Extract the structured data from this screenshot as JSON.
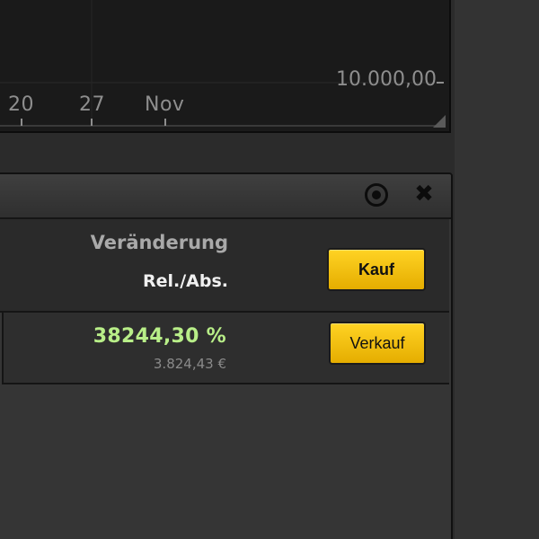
{
  "chart": {
    "x_ticks": [
      "20",
      "27",
      "Nov"
    ],
    "y_tick": "10.000,00"
  },
  "window": {
    "target_icon": "target-icon",
    "close_icon": "close-icon",
    "close_glyph": "✖"
  },
  "table": {
    "column_header": "Veränderung",
    "column_subheader": "Rel./Abs.",
    "rows": [
      {
        "rel_change": "38244,30 %",
        "abs_change": "3.824,43 €"
      }
    ]
  },
  "buttons": {
    "buy_label": "Kauf",
    "sell_label": "Verkauf"
  },
  "colors": {
    "positive": "#b8ee88",
    "button_yellow": "#f5c400",
    "background": "#2b2b2b"
  }
}
